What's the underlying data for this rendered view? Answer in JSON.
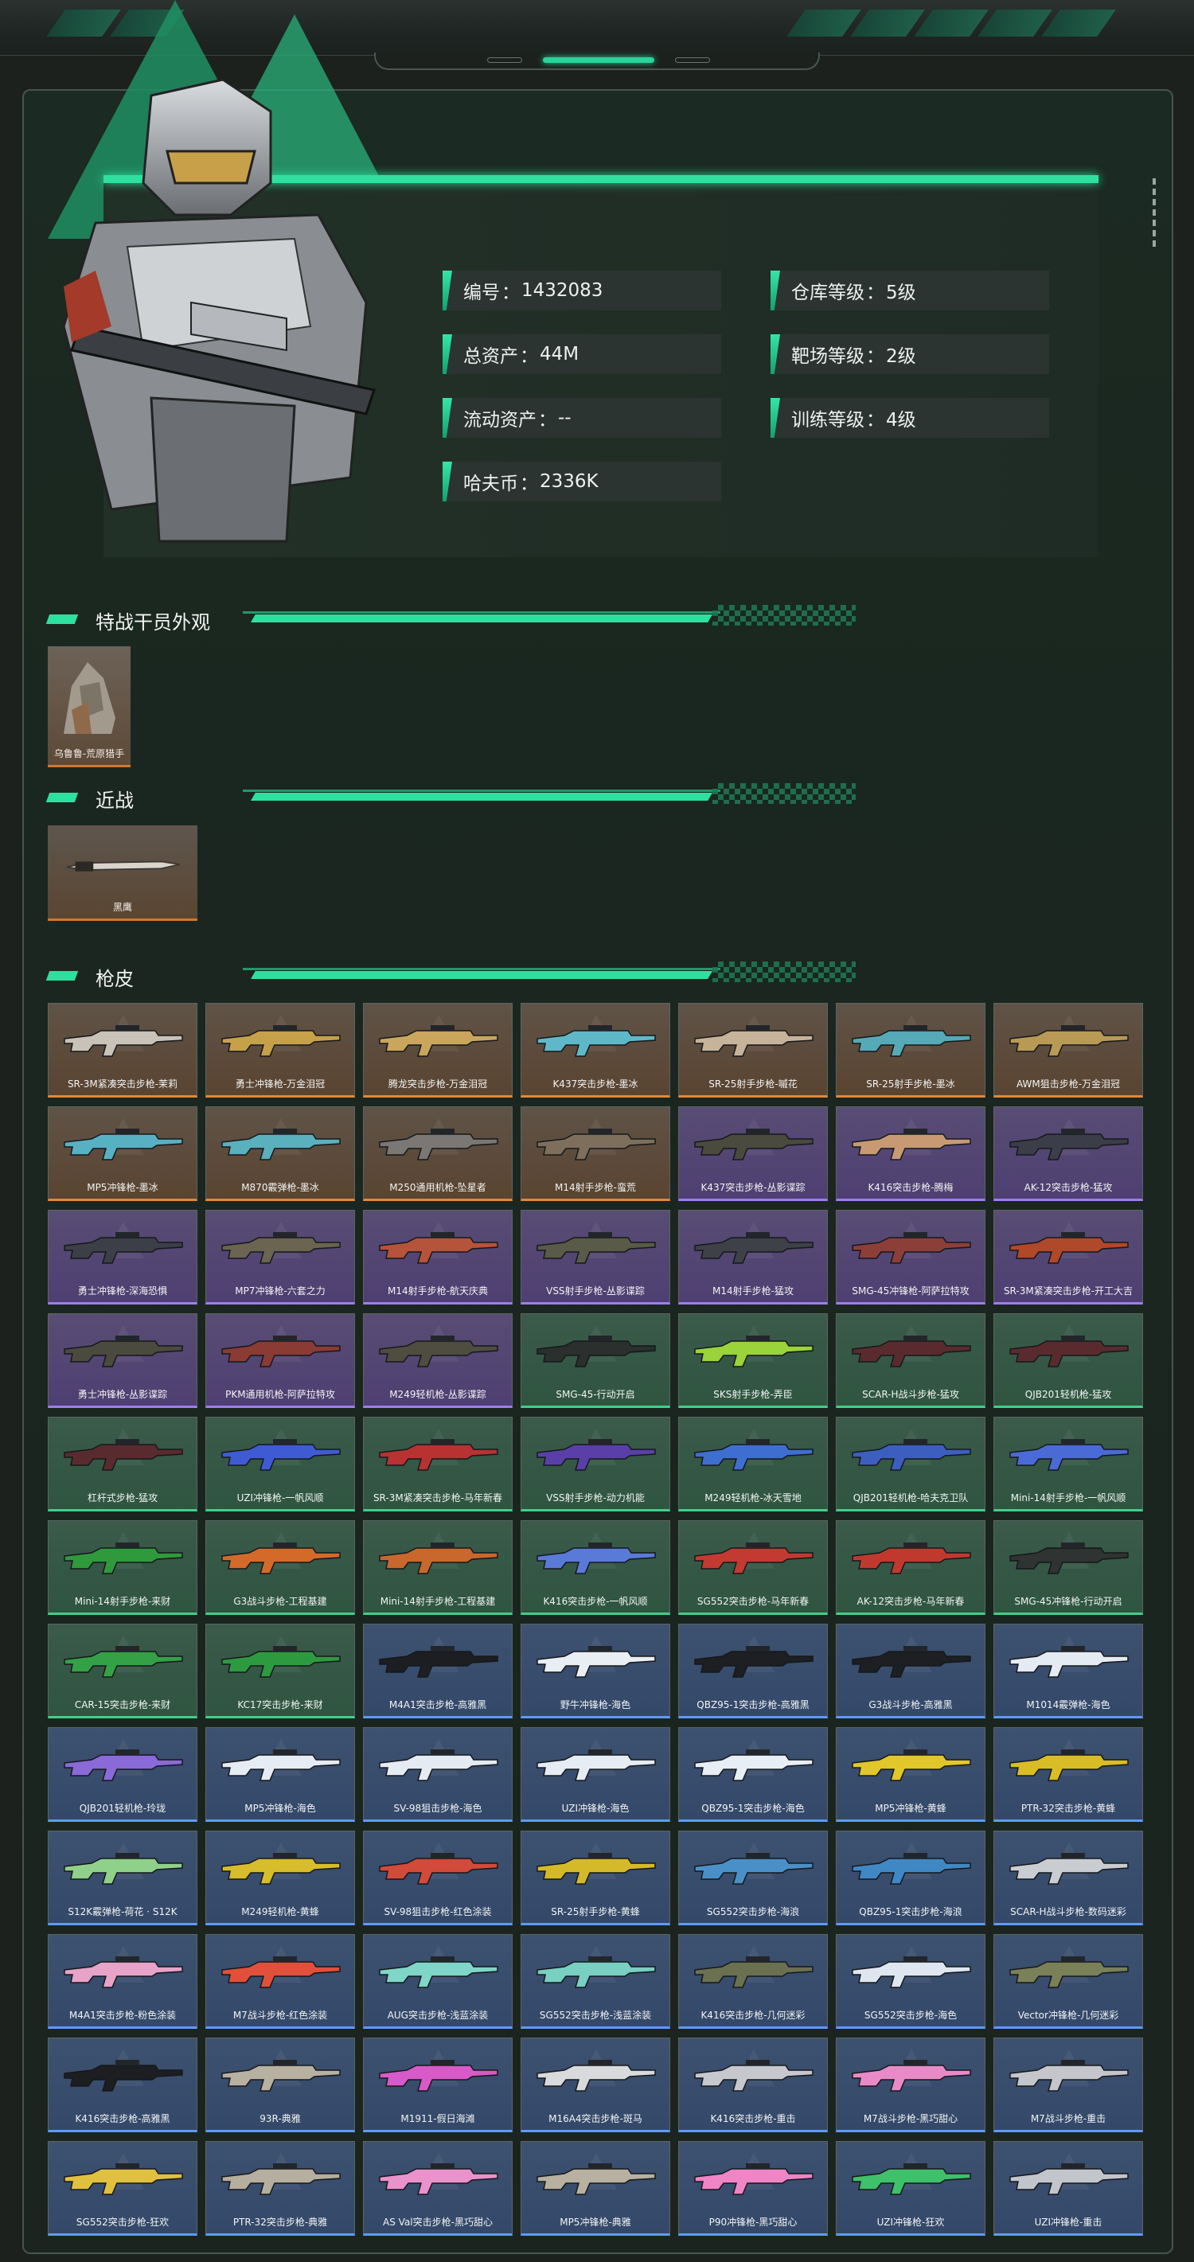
{
  "profile": {
    "stats": [
      {
        "label": "编号",
        "value": "1432083"
      },
      {
        "label": "仓库等级",
        "value": "5级"
      },
      {
        "label": "总资产",
        "value": "44M"
      },
      {
        "label": "靶场等级",
        "value": "2级"
      },
      {
        "label": "流动资产",
        "value": "--"
      },
      {
        "label": "训练等级",
        "value": "4级"
      },
      {
        "label": "哈夫币",
        "value": "2336K"
      }
    ]
  },
  "sections": {
    "appearance": "特战干员外观",
    "melee": "近战",
    "gun_skins": "枪皮"
  },
  "appearance_items": [
    {
      "name": "乌鲁鲁-荒原猎手"
    }
  ],
  "melee_items": [
    {
      "name": "黑鹰"
    }
  ],
  "colors": {
    "orange": "#e08a3a",
    "purple": "#a07cf0",
    "green": "#41cf8b",
    "blue": "#5d9bff",
    "accent": "#2ee0a0"
  },
  "gun_skins": [
    {
      "name": "SR-3M紧凑突击步枪-茉莉",
      "rarity": "orange",
      "color": "#c9c2b8"
    },
    {
      "name": "勇士冲锋枪-万金泪冠",
      "rarity": "orange",
      "color": "#c7a04a"
    },
    {
      "name": "腾龙突击步枪-万金泪冠",
      "rarity": "orange",
      "color": "#c9a65c"
    },
    {
      "name": "K437突击步枪-墨冰",
      "rarity": "orange",
      "color": "#5fb8c8"
    },
    {
      "name": "SR-25射手步枪-嘁花",
      "rarity": "orange",
      "color": "#c7b29a"
    },
    {
      "name": "SR-25射手步枪-墨冰",
      "rarity": "orange",
      "color": "#56a9b6"
    },
    {
      "name": "AWM狙击步枪-万金泪冠",
      "rarity": "orange",
      "color": "#b89a55"
    },
    {
      "name": "MP5冲锋枪-墨冰",
      "rarity": "orange",
      "color": "#58b1c3"
    },
    {
      "name": "M870霰弹枪-墨冰",
      "rarity": "orange",
      "color": "#5ab0bd"
    },
    {
      "name": "M250通用机枪-坠星者",
      "rarity": "orange",
      "color": "#7b7775"
    },
    {
      "name": "M14射手步枪-蛮荒",
      "rarity": "orange",
      "color": "#7e6f5c"
    },
    {
      "name": "K437突击步枪-丛影谍踪",
      "rarity": "purple",
      "color": "#4a4b3e"
    },
    {
      "name": "K416突击步枪-腾梅",
      "rarity": "purple",
      "color": "#c79a74"
    },
    {
      "name": "AK-12突击步枪-猛攻",
      "rarity": "purple",
      "color": "#3b3e48"
    },
    {
      "name": "勇士冲锋枪-深海恐惧",
      "rarity": "purple",
      "color": "#3c3f47"
    },
    {
      "name": "MP7冲锋枪-六套之力",
      "rarity": "purple",
      "color": "#6a6450"
    },
    {
      "name": "M14射手步枪-航天庆典",
      "rarity": "purple",
      "color": "#b5543a"
    },
    {
      "name": "VSS射手步枪-丛影谍踪",
      "rarity": "purple",
      "color": "#5a5a48"
    },
    {
      "name": "M14射手步枪-猛攻",
      "rarity": "purple",
      "color": "#3f4149"
    },
    {
      "name": "SMG-45冲锋枪-阿萨拉特攻",
      "rarity": "purple",
      "color": "#8c3f38"
    },
    {
      "name": "SR-3M紧凑突击步枪-开工大吉",
      "rarity": "purple",
      "color": "#b0482a"
    },
    {
      "name": "勇士冲锋枪-丛影谍踪",
      "rarity": "purple",
      "color": "#4b4a3e"
    },
    {
      "name": "PKM通用机枪-阿萨拉特攻",
      "rarity": "purple",
      "color": "#8a3b33"
    },
    {
      "name": "M249轻机枪-丛影谍踪",
      "rarity": "purple",
      "color": "#4e4d40"
    },
    {
      "name": "SMG-45-行动开启",
      "rarity": "green",
      "color": "#2b2f2e"
    },
    {
      "name": "SKS射手步枪-弄臣",
      "rarity": "green",
      "color": "#9ad33a"
    },
    {
      "name": "SCAR-H战斗步枪-猛攻",
      "rarity": "green",
      "color": "#5a2b2e"
    },
    {
      "name": "QJB201轻机枪-猛攻",
      "rarity": "green",
      "color": "#5a2b2e"
    },
    {
      "name": "杠杆式步枪-猛攻",
      "rarity": "green",
      "color": "#5a2b2e"
    },
    {
      "name": "UZI冲锋枪-一帆风顺",
      "rarity": "green",
      "color": "#3f5bd4"
    },
    {
      "name": "SR-3M紧凑突击步枪-马年新春",
      "rarity": "green",
      "color": "#b83232"
    },
    {
      "name": "VSS射手步枪-动力机能",
      "rarity": "green",
      "color": "#5a3fa8"
    },
    {
      "name": "M249轻机枪-冰天雪地",
      "rarity": "green",
      "color": "#3e6fd0"
    },
    {
      "name": "QJB201轻机枪-哈夫克卫队",
      "rarity": "green",
      "color": "#3c5fbf"
    },
    {
      "name": "Mini-14射手步枪-一帆风顺",
      "rarity": "green",
      "color": "#4a6ad6"
    },
    {
      "name": "Mini-14射手步枪-来财",
      "rarity": "green",
      "color": "#2f9a3c"
    },
    {
      "name": "G3战斗步枪-工程基建",
      "rarity": "green",
      "color": "#d36a2a"
    },
    {
      "name": "Mini-14射手步枪-工程基建",
      "rarity": "green",
      "color": "#c8682c"
    },
    {
      "name": "K416突击步枪-一帆风顺",
      "rarity": "green",
      "color": "#5a7ad8"
    },
    {
      "name": "SG552突击步枪-马年新春",
      "rarity": "green",
      "color": "#c23a32"
    },
    {
      "name": "AK-12突击步枪-马年新春",
      "rarity": "green",
      "color": "#c0392f"
    },
    {
      "name": "SMG-45冲锋枪-行动开启",
      "rarity": "green",
      "color": "#2f3331"
    },
    {
      "name": "CAR-15突击步枪-来财",
      "rarity": "green",
      "color": "#34a146"
    },
    {
      "name": "KC17突击步枪-来财",
      "rarity": "green",
      "color": "#2e9a40"
    },
    {
      "name": "M4A1突击步枪-高雅黑",
      "rarity": "blue",
      "color": "#1c1e22"
    },
    {
      "name": "野牛冲锋枪-海色",
      "rarity": "blue",
      "color": "#e9eef5"
    },
    {
      "name": "QBZ95-1突击步枪-高雅黑",
      "rarity": "blue",
      "color": "#1d1f23"
    },
    {
      "name": "G3战斗步枪-高雅黑",
      "rarity": "blue",
      "color": "#1d1f23"
    },
    {
      "name": "M1014霰弹枪-海色",
      "rarity": "blue",
      "color": "#e5ebf3"
    },
    {
      "name": "QJB201轻机枪-玲珑",
      "rarity": "blue",
      "color": "#8a6ad8"
    },
    {
      "name": "MP5冲锋枪-海色",
      "rarity": "blue",
      "color": "#e6ecf4"
    },
    {
      "name": "SV-98狙击步枪-海色",
      "rarity": "blue",
      "color": "#e5ebf3"
    },
    {
      "name": "UZI冲锋枪-海色",
      "rarity": "blue",
      "color": "#e6ecf4"
    },
    {
      "name": "QBZ95-1突击步枪-海色",
      "rarity": "blue",
      "color": "#e8eef6"
    },
    {
      "name": "MP5冲锋枪-黄蜂",
      "rarity": "blue",
      "color": "#e2c72a"
    },
    {
      "name": "PTR-32突击步枪-黄蜂",
      "rarity": "blue",
      "color": "#d9bd26"
    },
    {
      "name": "S12K霰弹枪-荷花 · S12K",
      "rarity": "blue",
      "color": "#8fd08a"
    },
    {
      "name": "M249轻机枪-黄蜂",
      "rarity": "blue",
      "color": "#d7bc2c"
    },
    {
      "name": "SV-98狙击步枪-红色涂装",
      "rarity": "blue",
      "color": "#d24a3a"
    },
    {
      "name": "SR-25射手步枪-黄蜂",
      "rarity": "blue",
      "color": "#d4ba2a"
    },
    {
      "name": "SG552突击步枪-海浪",
      "rarity": "blue",
      "color": "#4a90c8"
    },
    {
      "name": "QBZ95-1突击步枪-海浪",
      "rarity": "blue",
      "color": "#3f88c4"
    },
    {
      "name": "SCAR-H战斗步枪-数码迷彩",
      "rarity": "blue",
      "color": "#c9ccd0"
    },
    {
      "name": "M4A1突击步枪-粉色涂装",
      "rarity": "blue",
      "color": "#e7a3c8"
    },
    {
      "name": "M7战斗步枪-红色涂装",
      "rarity": "blue",
      "color": "#e0503a"
    },
    {
      "name": "AUG突击步枪-浅蓝涂装",
      "rarity": "blue",
      "color": "#7fd6c8"
    },
    {
      "name": "SG552突击步枪-浅蓝涂装",
      "rarity": "blue",
      "color": "#78cfc2"
    },
    {
      "name": "K416突击步枪-几何迷彩",
      "rarity": "blue",
      "color": "#6a7050"
    },
    {
      "name": "SG552突击步枪-海色",
      "rarity": "blue",
      "color": "#dfe6f0"
    },
    {
      "name": "Vector冲锋枪-几何迷彩",
      "rarity": "blue",
      "color": "#7a8058"
    },
    {
      "name": "K416突击步枪-高雅黑",
      "rarity": "blue",
      "color": "#1c1e22"
    },
    {
      "name": "93R-典雅",
      "rarity": "blue",
      "color": "#b8b0a0"
    },
    {
      "name": "M1911-假日海滩",
      "rarity": "blue",
      "color": "#d85ac8"
    },
    {
      "name": "M16A4突击步枪-斑马",
      "rarity": "blue",
      "color": "#d8dadc"
    },
    {
      "name": "K416突击步枪-重击",
      "rarity": "blue",
      "color": "#c6c8ce"
    },
    {
      "name": "M7战斗步枪-黑巧甜心",
      "rarity": "blue",
      "color": "#e88ac8"
    },
    {
      "name": "M7战斗步枪-重击",
      "rarity": "blue",
      "color": "#c4c6cc"
    },
    {
      "name": "SG552突击步枪-狂欢",
      "rarity": "blue",
      "color": "#e0c040"
    },
    {
      "name": "PTR-32突击步枪-典雅",
      "rarity": "blue",
      "color": "#b6ae9e"
    },
    {
      "name": "AS Val突击步枪-黑巧甜心",
      "rarity": "blue",
      "color": "#ea92cc"
    },
    {
      "name": "MP5冲锋枪-典雅",
      "rarity": "blue",
      "color": "#b8b0a0"
    },
    {
      "name": "P90冲锋枪-黑巧甜心",
      "rarity": "blue",
      "color": "#ef84c6"
    },
    {
      "name": "UZI冲锋枪-狂欢",
      "rarity": "blue",
      "color": "#3fc06a"
    },
    {
      "name": "UZI冲锋枪-重击",
      "rarity": "blue",
      "color": "#c2c5cc"
    }
  ]
}
